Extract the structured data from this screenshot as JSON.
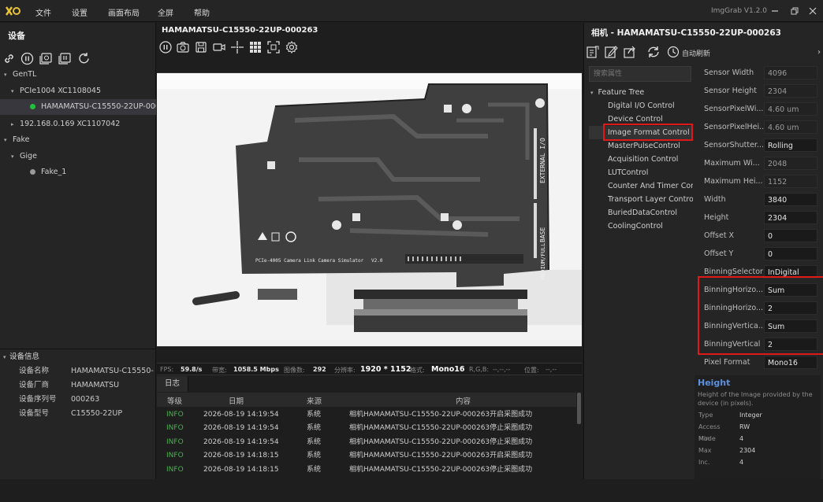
{
  "titlebar": {
    "logo": "X",
    "menus": [
      "文件",
      "设置",
      "画面布局",
      "全屏",
      "帮助"
    ],
    "app_version": "ImgGrab V1.2.0",
    "window_controls": [
      "minimize",
      "restore",
      "close"
    ]
  },
  "left_panel": {
    "header": "设备",
    "toolbar_icons": [
      "link-icon",
      "pause-icon",
      "gallery-icon",
      "gallery-record-icon",
      "refresh-icon"
    ],
    "tree": [
      {
        "label": "GenTL",
        "level": 0,
        "expanded": true
      },
      {
        "label": "PCIe1004 XC1108045",
        "level": 1,
        "expanded": true
      },
      {
        "label": "HAMAMATSU-C15550-22UP-000...",
        "level": 2,
        "status_color": "#22c03c",
        "selected": true
      },
      {
        "label": "192.168.0.169 XC1107042",
        "level": 1,
        "expanded": false
      },
      {
        "label": "Fake",
        "level": 0,
        "expanded": true
      },
      {
        "label": "Gige",
        "level": 1,
        "expanded": true
      },
      {
        "label": "Fake_1",
        "level": 2,
        "status_color": "#9a9a9a"
      }
    ],
    "device_info": {
      "header": "设备信息",
      "rows": [
        {
          "key": "设备名称",
          "value": "HAMAMATSU-C15550-..."
        },
        {
          "key": "设备厂商",
          "value": "HAMAMATSU"
        },
        {
          "key": "设备序列号",
          "value": "000263"
        },
        {
          "key": "设备型号",
          "value": "C15550-22UP"
        }
      ]
    }
  },
  "center": {
    "camera_title": "HAMAMATSU-C15550-22UP-000263",
    "toolbar_icons": [
      "pause-icon",
      "camera-icon",
      "save-icon",
      "video-icon",
      "crosshair-icon",
      "grid-icon",
      "fit-icon",
      "settings-icon"
    ],
    "image_text": {
      "board_label": "PCIe-4005 Camera Link Camera Simulator",
      "board_version": "V2.0",
      "external_io": "EXTERNAL I/O",
      "base": "BASE",
      "medium_full": "MEDIUM/FULL"
    },
    "status": {
      "fps_label": "FPS:",
      "fps_value": "59.8/s",
      "bandwidth_label": "带宽:",
      "bandwidth_value": "1058.5 Mbps",
      "frames_label": "图像数:",
      "frames_value": "292",
      "resolution_label": "分辨率:",
      "resolution_value": "1920 * 1152",
      "format_label": "格式:",
      "format_value": "Mono16",
      "rgb_label": "R,G,B:",
      "rgb_value": "--,--,--",
      "pos_label": "位置:",
      "pos_value": "--,--"
    },
    "log": {
      "tab": "日志",
      "columns": [
        "等级",
        "日期",
        "来源",
        "内容"
      ],
      "rows": [
        {
          "level": "INFO",
          "date": "2026-08-19 14:19:54",
          "source": "系统",
          "content": "相机HAMAMATSU-C15550-22UP-000263开启采图成功"
        },
        {
          "level": "INFO",
          "date": "2026-08-19 14:19:54",
          "source": "系统",
          "content": "相机HAMAMATSU-C15550-22UP-000263停止采图成功"
        },
        {
          "level": "INFO",
          "date": "2026-08-19 14:19:54",
          "source": "系统",
          "content": "相机HAMAMATSU-C15550-22UP-000263停止采图成功"
        },
        {
          "level": "INFO",
          "date": "2026-08-19 14:18:15",
          "source": "系统",
          "content": "相机HAMAMATSU-C15550-22UP-000263开启采图成功"
        },
        {
          "level": "INFO",
          "date": "2026-08-19 14:18:15",
          "source": "系统",
          "content": "相机HAMAMATSU-C15550-22UP-000263停止采图成功"
        }
      ]
    }
  },
  "right_panel": {
    "title": "相机 - HAMAMATSU-C15550-22UP-000263",
    "toolbar_icons": [
      "export-icon",
      "edit-icon",
      "share-icon",
      "refresh-icon",
      "clock-icon"
    ],
    "auto_refresh": "自动刷新",
    "search_placeholder": "搜索属性",
    "feature_tree": {
      "root": "Feature Tree",
      "items": [
        "Digital I/O Control",
        "Device Control",
        "Image Format Control",
        "MasterPulseControl",
        "Acquisition Control",
        "LUTControl",
        "Counter And Timer Contr",
        "Transport Layer Control",
        "BuriedDataControl",
        "CoolingControl"
      ],
      "selected": "Image Format Control"
    },
    "properties": [
      {
        "name": "Sensor Width",
        "value": "4096",
        "readonly": true
      },
      {
        "name": "Sensor Height",
        "value": "2304",
        "readonly": true
      },
      {
        "name": "SensorPixelWi...",
        "value": "4.60 um",
        "readonly": true
      },
      {
        "name": "SensorPixelHei...",
        "value": "4.60 um",
        "readonly": true
      },
      {
        "name": "SensorShutter...",
        "value": "Rolling",
        "readonly": false
      },
      {
        "name": "Maximum Wi...",
        "value": "2048",
        "readonly": true
      },
      {
        "name": "Maximum Hei...",
        "value": "1152",
        "readonly": true
      },
      {
        "name": "Width",
        "value": "3840",
        "readonly": false
      },
      {
        "name": "Height",
        "value": "2304",
        "readonly": false
      },
      {
        "name": "Offset X",
        "value": "0",
        "readonly": false
      },
      {
        "name": "Offset Y",
        "value": "0",
        "readonly": false
      },
      {
        "name": "BinningSelector",
        "value": "InDigital",
        "readonly": false
      },
      {
        "name": "BinningHorizo...",
        "value": "Sum",
        "readonly": false
      },
      {
        "name": "BinningHorizo...",
        "value": "2",
        "readonly": false
      },
      {
        "name": "BinningVertica...",
        "value": "Sum",
        "readonly": false
      },
      {
        "name": "BinningVertical",
        "value": "2",
        "readonly": false
      },
      {
        "name": "Pixel Format",
        "value": "Mono16",
        "readonly": false
      }
    ],
    "property_info": {
      "title": "Height",
      "description": "Height of the Image provided by the device (in pixels).",
      "rows": [
        {
          "key": "Type",
          "value": "Integer"
        },
        {
          "key": "Access Mode",
          "value": "RW"
        },
        {
          "key": "Min",
          "value": "4"
        },
        {
          "key": "Max",
          "value": "2304"
        },
        {
          "key": "Inc.",
          "value": "4"
        }
      ]
    }
  }
}
